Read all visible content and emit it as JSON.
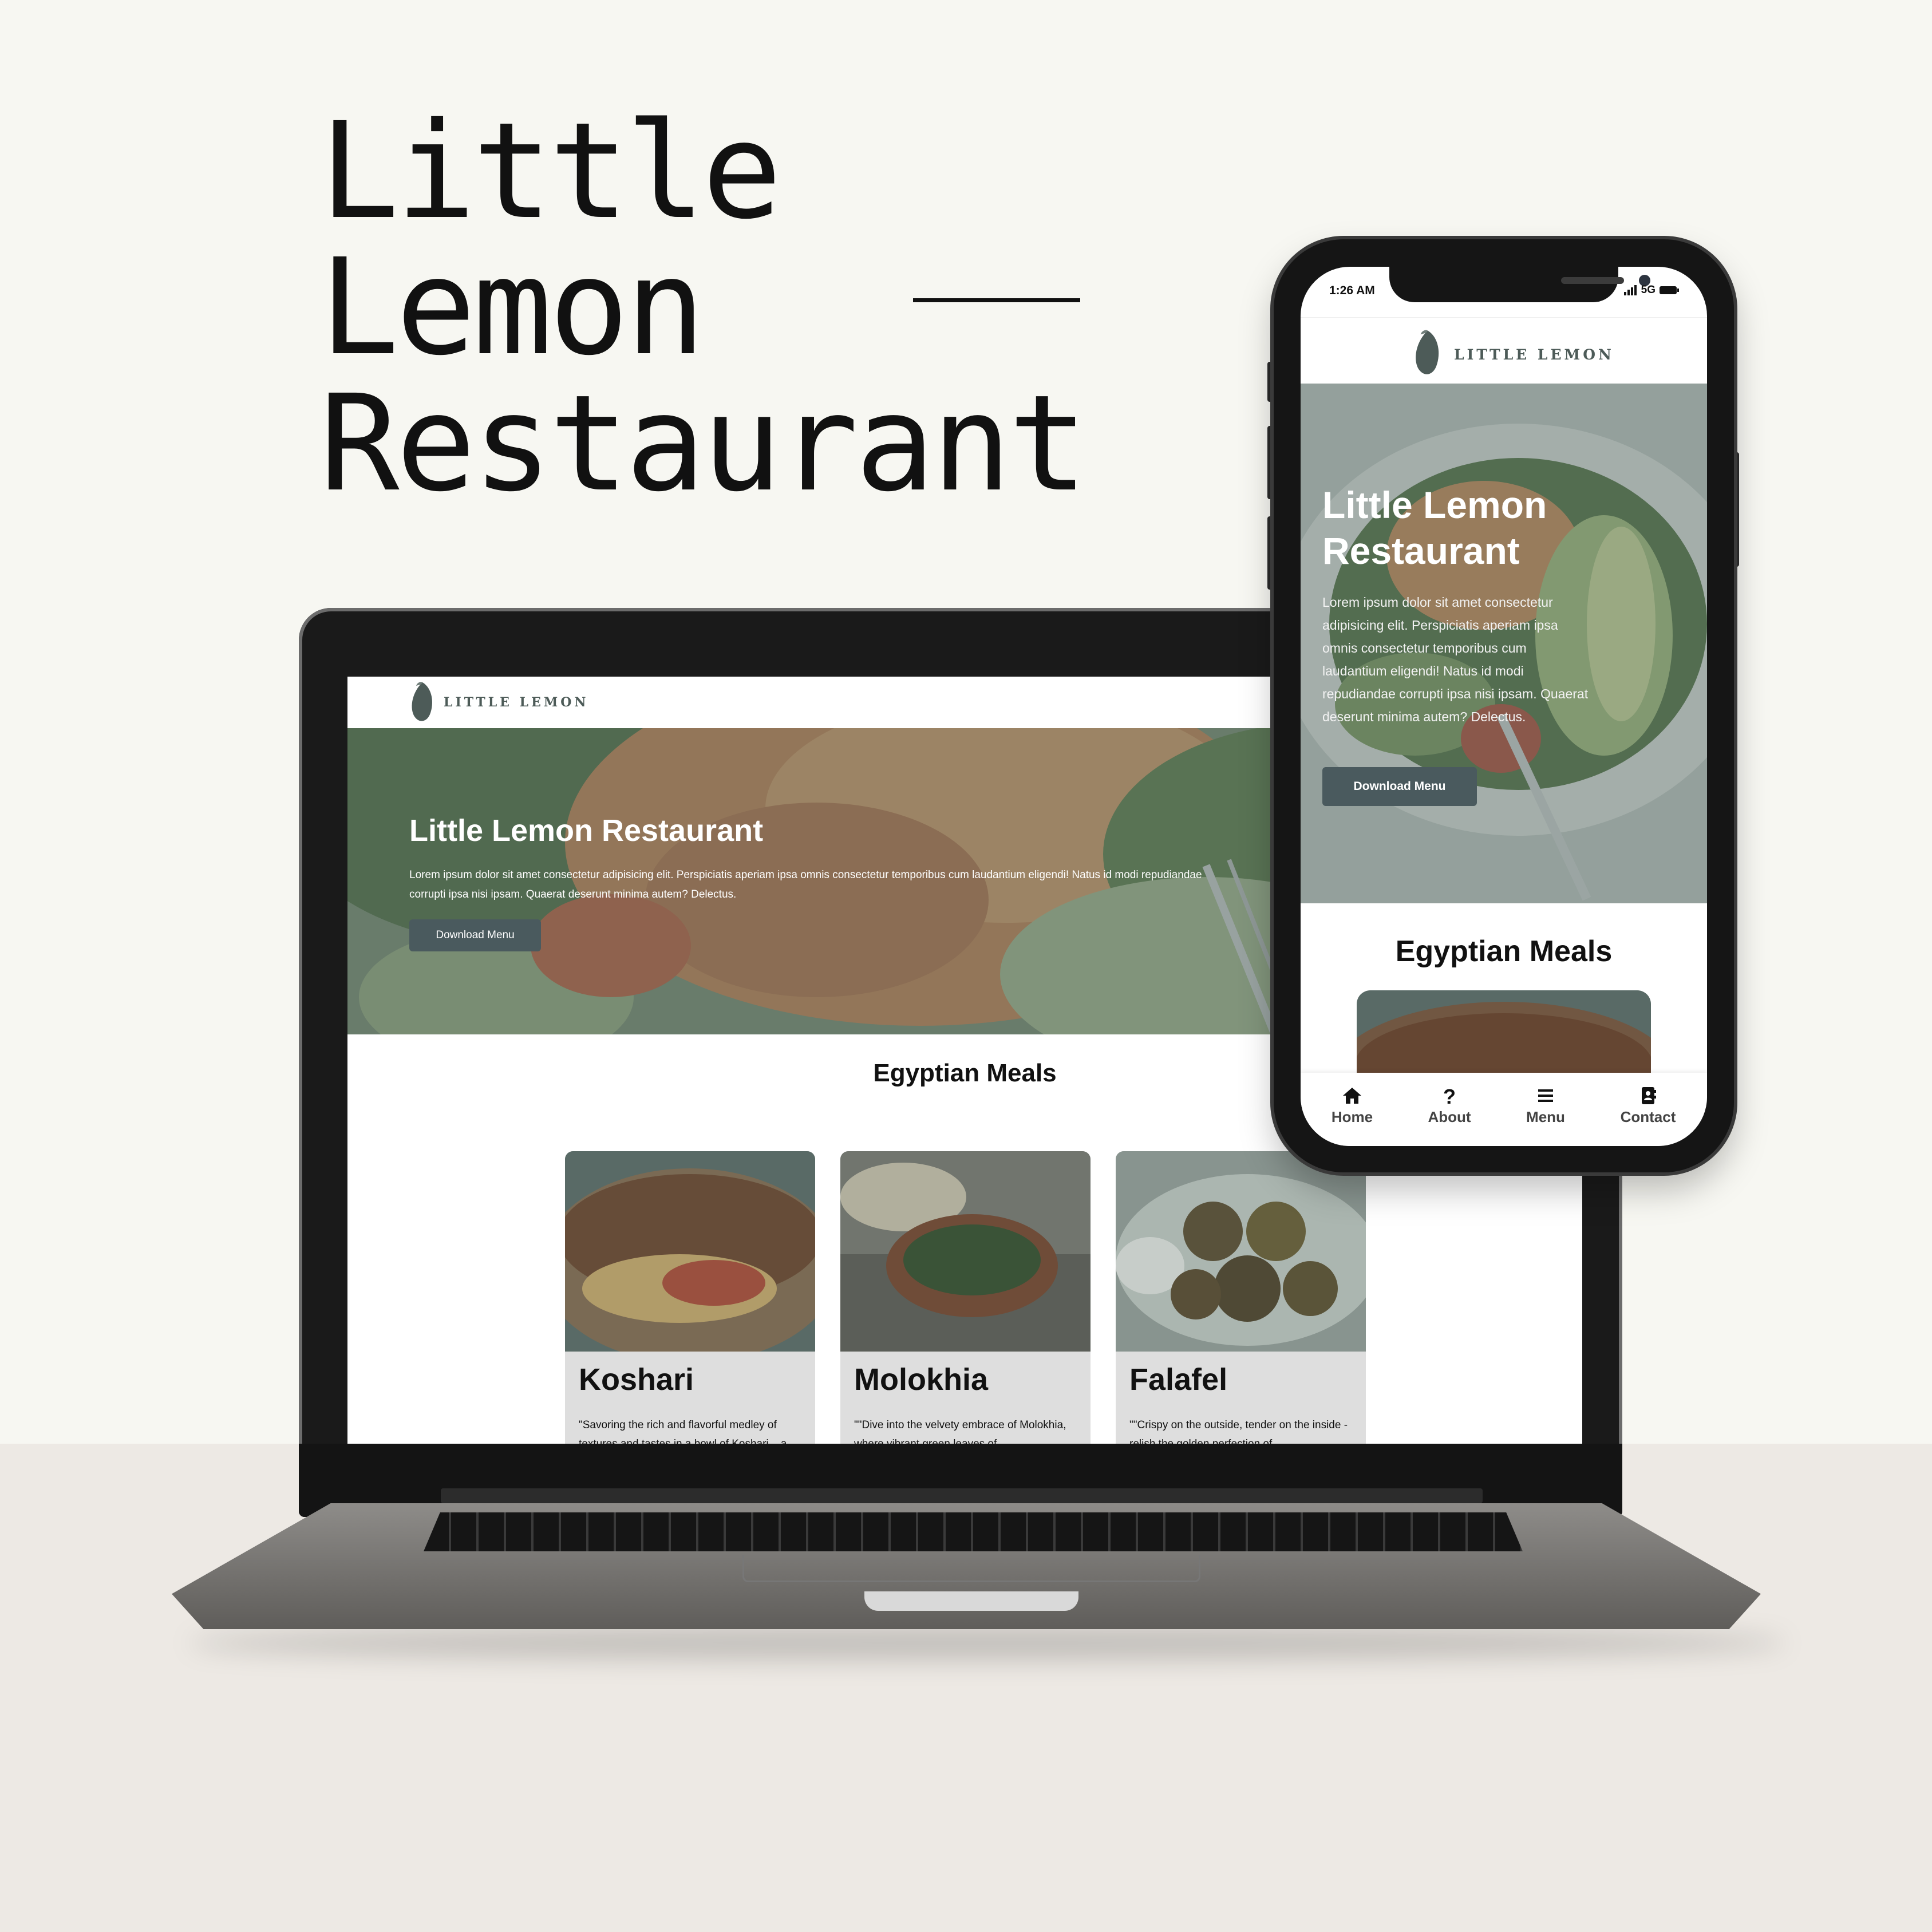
{
  "headline": {
    "lines": [
      "Little",
      "Lemon",
      "Restaurant"
    ]
  },
  "desktop": {
    "brand": "LITTLE LEMON",
    "hero": {
      "title": "Little Lemon Restaurant",
      "text": "Lorem ipsum dolor sit amet consectetur adipisicing elit. Perspiciatis aperiam ipsa omnis consectetur temporibus cum laudantium eligendi! Natus id modi repudiandae corrupti ipsa nisi ipsam. Quaerat deserunt minima autem? Delectus.",
      "button": "Download Menu"
    },
    "section_title": "Egyptian Meals",
    "cards": [
      {
        "title": "Koshari",
        "text": "\"Savoring the rich and flavorful medley of textures and tastes in a bowl of Koshari – a"
      },
      {
        "title": "Molokhia",
        "text": "\"\"Dive into the velvety embrace of Molokhia, where vibrant green leaves of"
      },
      {
        "title": "Falafel",
        "text": "\"\"Crispy on the outside, tender on the inside - relish the golden perfection of"
      }
    ]
  },
  "phone": {
    "status_time": "1:26 AM",
    "status_network": "5G",
    "brand": "LITTLE LEMON",
    "hero": {
      "title": "Little Lemon Restaurant",
      "text": "Lorem ipsum dolor sit amet consectetur adipisicing elit. Perspiciatis aperiam ipsa omnis consectetur temporibus cum laudantium eligendi! Natus id modi repudiandae corrupti ipsa nisi ipsam. Quaerat deserunt minima autem? Delectus.",
      "button": "Download Menu"
    },
    "section_title": "Egyptian Meals",
    "tabs": [
      {
        "label": "Home",
        "icon": "home-icon"
      },
      {
        "label": "About",
        "icon": "question-icon"
      },
      {
        "label": "Menu",
        "icon": "menu-icon"
      },
      {
        "label": "Contact",
        "icon": "contact-book-icon"
      }
    ]
  },
  "colors": {
    "background": "#f7f7f2",
    "floor": "#ede9e4",
    "button": "#4a5a5e",
    "brand_text": "#4d5b58",
    "card": "#dedede"
  }
}
